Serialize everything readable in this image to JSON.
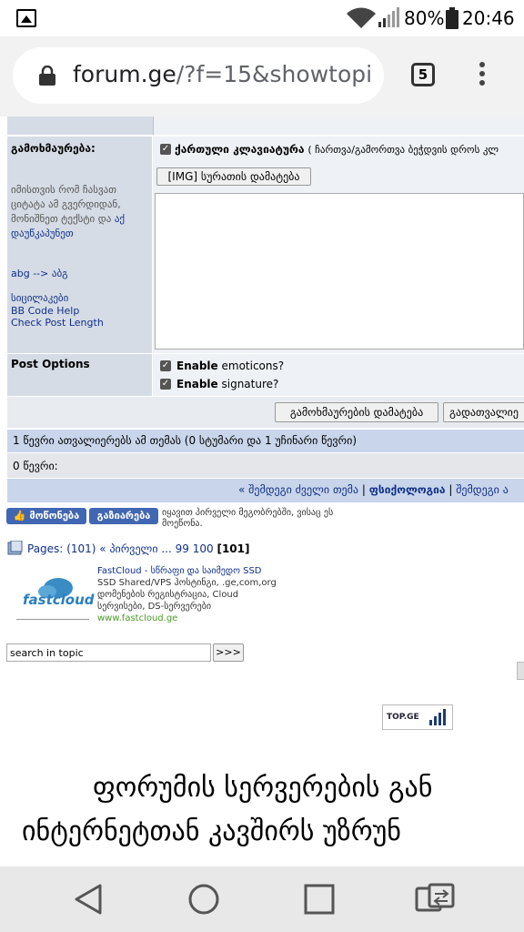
{
  "status_bar": {
    "battery": "80%",
    "time": "20:46"
  },
  "browser": {
    "url_host": "forum.ge",
    "url_path": "/?f=15&showtopic=",
    "tab_count": "5"
  },
  "reply": {
    "label": "გამოხმაურება:",
    "help_text": "იმისთვის რომ ჩასვათ ციტატა ამ გვერდიდან, მონიშნეთ ტექსტი და",
    "help_link": "აქ დაუწკაპუნეთ",
    "abg_link": "abg --> აბგ",
    "smilies_link": "სიცილაკები",
    "bbcode_link": "BB Code Help",
    "check_length_link": "Check Post Length",
    "keyboard_label": "ქართული კლავიატურა",
    "keyboard_hint": "( ჩართვა/გამორთვა ბეჭდვის დროს კლ",
    "img_button": "[IMG] სურათის დამატება",
    "message_value": ""
  },
  "post_options": {
    "label": "Post Options",
    "emoticons_bold": "Enable",
    "emoticons_rest": " emoticons?",
    "signature_bold": "Enable",
    "signature_rest": " signature?"
  },
  "buttons": {
    "add_reply": "გამოხმაურების დამატება",
    "preview": "გადათვალიე"
  },
  "readers": {
    "summary": "1 წევრი ათვალიერებს ამ თემას (0 სტუმარი და 1 უჩინარი წევრი)",
    "members": "0 წევრი:"
  },
  "topic_nav": {
    "older": "« შემდეგი ძველი თემა",
    "sep1": " | ",
    "forum": "ფსიქოლოგია",
    "sep2": " | ",
    "newer": "შემდეგი ა"
  },
  "facebook": {
    "like": "მოწონება",
    "share": "გაზიარება",
    "note": "იყავით პირველი მეგობრებში, ვისაც ეს მოეწონა."
  },
  "pages": {
    "label": "Pages:",
    "count": "(101)",
    "first": "« პირველი",
    "dots": " ... ",
    "p99": "99",
    "p100": "100",
    "current": "[101]"
  },
  "ad": {
    "logo": "fastcloud",
    "title": "FastCloud - სწრაფი და საიმედო SSD",
    "line1": "SSD Shared/VPS ჰოსტინგი, .ge,com,org",
    "line2": "დომენების რეგისტრაცია, Cloud",
    "line3": "სერვისები, DS-სერვერები",
    "url": "www.fastcloud.ge"
  },
  "search": {
    "value": "search in topic",
    "go": ">>>"
  },
  "topge": {
    "label": "TOP.GE"
  },
  "banner": {
    "line1": "ფორუმის სერვერების გან",
    "line2": "ინტერნეტთან კავშირს უზრუნ"
  }
}
